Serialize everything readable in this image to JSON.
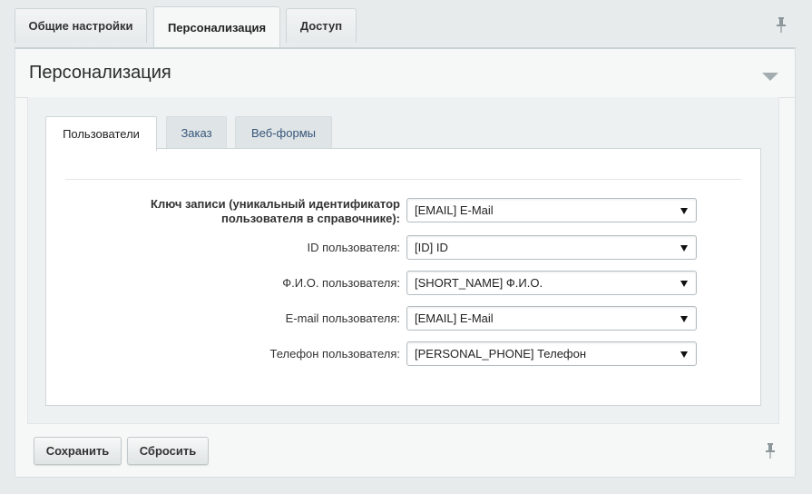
{
  "top_tabs": [
    {
      "label": "Общие настройки"
    },
    {
      "label": "Персонализация"
    },
    {
      "label": "Доступ"
    }
  ],
  "panel": {
    "title": "Персонализация"
  },
  "sub_tabs": [
    {
      "label": "Пользователи"
    },
    {
      "label": "Заказ"
    },
    {
      "label": "Веб-формы"
    }
  ],
  "form": {
    "key_label_line1": "Ключ записи (уникальный идентификатор",
    "key_label_line2": "пользователя в справочнике):",
    "key_value": "[EMAIL] E-Mail",
    "rows": [
      {
        "label": "ID пользователя:",
        "value": "[ID] ID"
      },
      {
        "label": "Ф.И.О. пользователя:",
        "value": "[SHORT_NAME] Ф.И.О."
      },
      {
        "label": "E-mail пользователя:",
        "value": "[EMAIL] E-Mail"
      },
      {
        "label": "Телефон пользователя:",
        "value": "[PERSONAL_PHONE] Телефон"
      }
    ]
  },
  "buttons": {
    "save": "Сохранить",
    "reset": "Сбросить"
  },
  "icons": {
    "pin": "pin-icon",
    "collapse": "triangle-down-icon",
    "select_arrow": "triangle-down-icon"
  }
}
